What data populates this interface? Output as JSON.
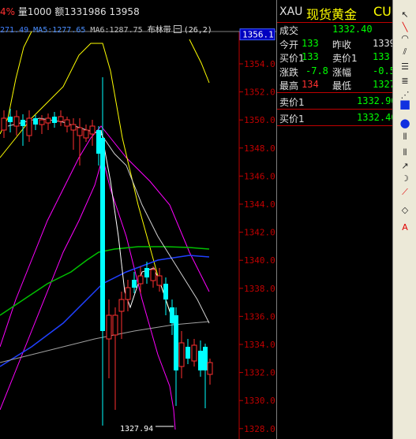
{
  "header": {
    "pct": "4%",
    "vol_label": "量1000",
    "amt_label": "额1331986",
    "amt_value": "13958"
  },
  "ma_line": {
    "ma1": "271.49",
    "ma2": "MA5:1277.65",
    "ma3": "MA6:1287.75",
    "boll": "布林带",
    "boll_params": "(26,2)"
  },
  "price_axis": {
    "labels": [
      "1354.0",
      "1352.0",
      "1350.0",
      "1348.0",
      "1346.0",
      "1344.0",
      "1342.0",
      "1340.0",
      "1338.0",
      "1336.0",
      "1334.0",
      "1332.0",
      "1330.0",
      "1328.0"
    ],
    "current": "1356.1"
  },
  "low_annotation": "1327.94",
  "quote": {
    "code": "XAU",
    "name": "现货黄金",
    "currency": "CUR",
    "rows": [
      {
        "label": "成交",
        "value": "1332.40",
        "value_color": "#00ff00"
      },
      {
        "label": "今开",
        "value": "133",
        "value_color": "#00ff00",
        "label2": "昨收",
        "value2": "1339",
        "value2_color": "#e0e0e0"
      },
      {
        "label": "买价1",
        "value": "133",
        "value_color": "#00ff00",
        "label2": "卖价1",
        "value2": "133",
        "value2_color": "#00ff00"
      },
      {
        "label": "涨跌",
        "value": "-7.8",
        "value_color": "#00ff00",
        "label2": "涨幅",
        "value2": "-0.5",
        "value2_color": "#00ff00"
      },
      {
        "label": "最高",
        "value": "134",
        "value_color": "#ff3030",
        "label2": "最低",
        "value2": "1327",
        "value2_color": "#00ff00"
      }
    ],
    "order_rows": [
      {
        "label": "卖价1",
        "value": "1332.90"
      },
      {
        "label": "买价1",
        "value": "1332.40"
      }
    ]
  },
  "toolbar": {
    "icons": [
      "pointer-icon",
      "line-icon",
      "arc-icon",
      "parallel-lines-icon",
      "channel-icon",
      "fibonacci-icon",
      "gann-fan-icon",
      "rectangle-icon",
      "ellipse-icon",
      "cycle-lines-icon",
      "vertical-lines-icon",
      "arrow-icon",
      "curve-icon",
      "ray-icon",
      "eraser-icon",
      "text-icon"
    ],
    "text_label": "A"
  },
  "colors": {
    "up_candle": "#ff3030",
    "down_candle": "#00ffff",
    "grid": "#c00000",
    "boll_upper": "#ff00ff",
    "boll_mid": "#ffffff",
    "ma_yellow": "#ffff00",
    "ma_green": "#00c000",
    "ma_blue": "#2040ff",
    "ma_gray": "#a0a0a0"
  }
}
